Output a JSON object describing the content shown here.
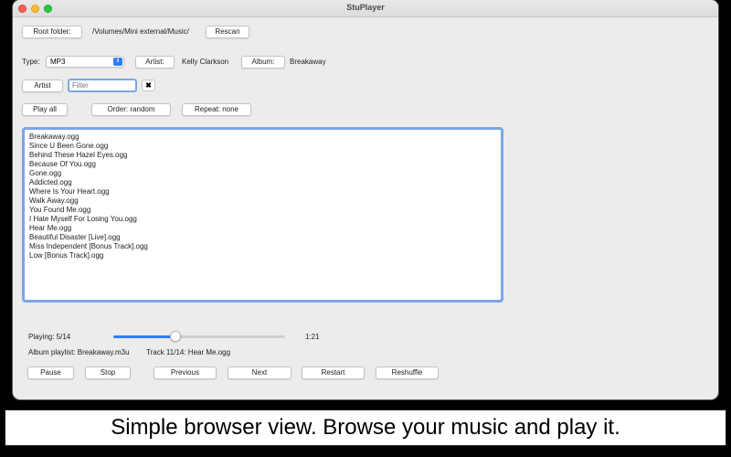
{
  "window": {
    "title": "StuPlayer"
  },
  "root": {
    "button": "Root folder:",
    "path": "/Volumes/Mini external/Music/",
    "rescan": "Rescan"
  },
  "filters": {
    "type_label": "Type:",
    "type_value": "MP3",
    "artist_button": "Artist:",
    "artist_value": "Kelly Clarkson",
    "album_button": "Album:",
    "album_value": "Breakaway"
  },
  "search": {
    "field_button": "Artist",
    "placeholder": "Filter",
    "clear": "✖"
  },
  "controls": {
    "play_all": "Play all",
    "order": "Order: random",
    "repeat": "Repeat: none"
  },
  "tracks": [
    "Breakaway.ogg",
    "Since U Been Gone.ogg",
    "Behind These Hazel Eyes.ogg",
    "Because Of You.ogg",
    "Gone.ogg",
    "Addicted.ogg",
    "Where Is Your Heart.ogg",
    "Walk Away.ogg",
    "You Found Me.ogg",
    "I Hate Myself For Losing You.ogg",
    "Hear Me.ogg",
    "Beautiful Disaster [Live].ogg",
    "Miss Independent [Bonus Track].ogg",
    "Low [Bonus Track].ogg"
  ],
  "status": {
    "playing": "Playing: 5/14",
    "time": "1:21",
    "progress_fraction": 0.36,
    "playlist": "Album playlist: Breakaway.m3u",
    "track": "Track 11/14: Hear Me.ogg"
  },
  "transport": {
    "pause": "Pause",
    "stop": "Stop",
    "previous": "Previous",
    "next": "Next",
    "restart": "Restart",
    "reshuffle": "Reshuffle"
  },
  "caption": "Simple browser view. Browse your music and play it.",
  "colors": {
    "accent": "#2f7cf6",
    "focus_ring": "#7aa6e6"
  }
}
